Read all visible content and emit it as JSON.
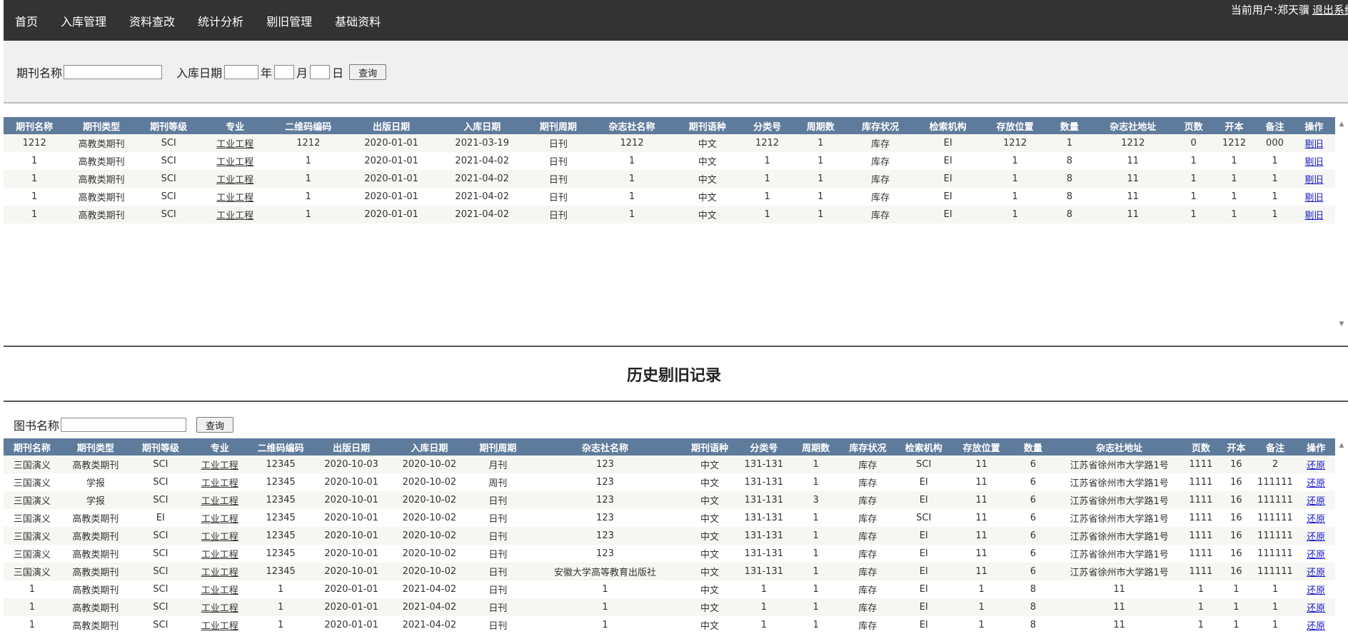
{
  "nav": {
    "items": [
      "首页",
      "入库管理",
      "资料查改",
      "统计分析",
      "剔旧管理",
      "基础资料"
    ],
    "user_label": "当前用户:郑天骥",
    "logout_label": "退出系统"
  },
  "search": {
    "journal_name_label": "期刊名称",
    "journal_name_value": "",
    "date_label": "入库日期",
    "year_unit": "年",
    "month_unit": "月",
    "day_unit": "日",
    "query_button": "查询"
  },
  "table1": {
    "headers": [
      "期刊名称",
      "期刊类型",
      "期刊等级",
      "专业",
      "二维码编码",
      "出版日期",
      "入库日期",
      "期刊周期",
      "杂志社名称",
      "期刊语种",
      "分类号",
      "周期数",
      "库存状况",
      "检索机构",
      "存放位置",
      "数量",
      "杂志社地址",
      "页数",
      "开本",
      "备注",
      "操作"
    ],
    "rows": [
      [
        "1212",
        "高教类期刊",
        "SCI",
        "工业工程",
        "1212",
        "2020-01-01",
        "2021-03-19",
        "日刊",
        "1212",
        "中文",
        "1212",
        "1",
        "库存",
        "EI",
        "1212",
        "1",
        "1212",
        "0",
        "1212",
        "000",
        "剔旧"
      ],
      [
        "1",
        "高教类期刊",
        "SCI",
        "工业工程",
        "1",
        "2020-01-01",
        "2021-04-02",
        "日刊",
        "1",
        "中文",
        "1",
        "1",
        "库存",
        "EI",
        "1",
        "8",
        "11",
        "1",
        "1",
        "1",
        "剔旧"
      ],
      [
        "1",
        "高教类期刊",
        "SCI",
        "工业工程",
        "1",
        "2020-01-01",
        "2021-04-02",
        "日刊",
        "1",
        "中文",
        "1",
        "1",
        "库存",
        "EI",
        "1",
        "8",
        "11",
        "1",
        "1",
        "1",
        "剔旧"
      ],
      [
        "1",
        "高教类期刊",
        "SCI",
        "工业工程",
        "1",
        "2020-01-01",
        "2021-04-02",
        "日刊",
        "1",
        "中文",
        "1",
        "1",
        "库存",
        "EI",
        "1",
        "8",
        "11",
        "1",
        "1",
        "1",
        "剔旧"
      ],
      [
        "1",
        "高教类期刊",
        "SCI",
        "工业工程",
        "1",
        "2020-01-01",
        "2021-04-02",
        "日刊",
        "1",
        "中文",
        "1",
        "1",
        "库存",
        "EI",
        "1",
        "8",
        "11",
        "1",
        "1",
        "1",
        "剔旧"
      ]
    ]
  },
  "history": {
    "title": "历史剔旧记录",
    "book_name_label": "图书名称",
    "book_name_value": "",
    "query_button": "查询"
  },
  "table2": {
    "headers": [
      "期刊名称",
      "期刊类型",
      "期刊等级",
      "专业",
      "二维码编码",
      "出版日期",
      "入库日期",
      "期刊周期",
      "杂志社名称",
      "期刊语种",
      "分类号",
      "周期数",
      "库存状况",
      "检索机构",
      "存放位置",
      "数量",
      "杂志社地址",
      "页数",
      "开本",
      "备注",
      "操作"
    ],
    "rows": [
      [
        "三国演义",
        "高教类期刊",
        "SCI",
        "工业工程",
        "12345",
        "2020-10-03",
        "2020-10-02",
        "月刊",
        "123",
        "中文",
        "131-131",
        "1",
        "库存",
        "SCI",
        "11",
        "6",
        "江苏省徐州市大学路1号",
        "1111",
        "16",
        "2",
        "还原"
      ],
      [
        "三国演义",
        "学报",
        "SCI",
        "工业工程",
        "12345",
        "2020-10-01",
        "2020-10-02",
        "周刊",
        "123",
        "中文",
        "131-131",
        "1",
        "库存",
        "EI",
        "11",
        "6",
        "江苏省徐州市大学路1号",
        "1111",
        "16",
        "111111",
        "还原"
      ],
      [
        "三国演义",
        "学报",
        "SCI",
        "工业工程",
        "12345",
        "2020-10-01",
        "2020-10-02",
        "日刊",
        "123",
        "中文",
        "131-131",
        "3",
        "库存",
        "EI",
        "11",
        "6",
        "江苏省徐州市大学路1号",
        "1111",
        "16",
        "111111",
        "还原"
      ],
      [
        "三国演义",
        "高教类期刊",
        "EI",
        "工业工程",
        "12345",
        "2020-10-01",
        "2020-10-02",
        "日刊",
        "123",
        "中文",
        "131-131",
        "1",
        "库存",
        "SCI",
        "11",
        "6",
        "江苏省徐州市大学路1号",
        "1111",
        "16",
        "111111",
        "还原"
      ],
      [
        "三国演义",
        "高教类期刊",
        "SCI",
        "工业工程",
        "12345",
        "2020-10-01",
        "2020-10-02",
        "日刊",
        "123",
        "中文",
        "131-131",
        "1",
        "库存",
        "EI",
        "11",
        "6",
        "江苏省徐州市大学路1号",
        "1111",
        "16",
        "111111",
        "还原"
      ],
      [
        "三国演义",
        "高教类期刊",
        "SCI",
        "工业工程",
        "12345",
        "2020-10-01",
        "2020-10-02",
        "日刊",
        "123",
        "中文",
        "131-131",
        "1",
        "库存",
        "EI",
        "11",
        "6",
        "江苏省徐州市大学路1号",
        "1111",
        "16",
        "111111",
        "还原"
      ],
      [
        "三国演义",
        "高教类期刊",
        "SCI",
        "工业工程",
        "12345",
        "2020-10-01",
        "2020-10-02",
        "日刊",
        "安徽大学高等教育出版社",
        "中文",
        "131-131",
        "1",
        "库存",
        "EI",
        "11",
        "6",
        "江苏省徐州市大学路1号",
        "1111",
        "16",
        "111111",
        "还原"
      ],
      [
        "1",
        "高教类期刊",
        "SCI",
        "工业工程",
        "1",
        "2020-01-01",
        "2021-04-02",
        "日刊",
        "1",
        "中文",
        "1",
        "1",
        "库存",
        "EI",
        "1",
        "8",
        "11",
        "1",
        "1",
        "1",
        "还原"
      ],
      [
        "1",
        "高教类期刊",
        "SCI",
        "工业工程",
        "1",
        "2020-01-01",
        "2021-04-02",
        "日刊",
        "1",
        "中文",
        "1",
        "1",
        "库存",
        "EI",
        "1",
        "8",
        "11",
        "1",
        "1",
        "1",
        "还原"
      ],
      [
        "1",
        "高教类期刊",
        "SCI",
        "工业工程",
        "1",
        "2020-01-01",
        "2021-04-02",
        "日刊",
        "1",
        "中文",
        "1",
        "1",
        "库存",
        "EI",
        "1",
        "8",
        "11",
        "1",
        "1",
        "1",
        "还原"
      ]
    ]
  },
  "icons": {
    "scroll_up": "scroll-up-arrow-icon",
    "scroll_down": "scroll-down-arrow-icon"
  },
  "colors": {
    "topbar_bg": "#333333",
    "table_header_bg": "#5f7b9c",
    "action_link": "#1a1acd"
  }
}
